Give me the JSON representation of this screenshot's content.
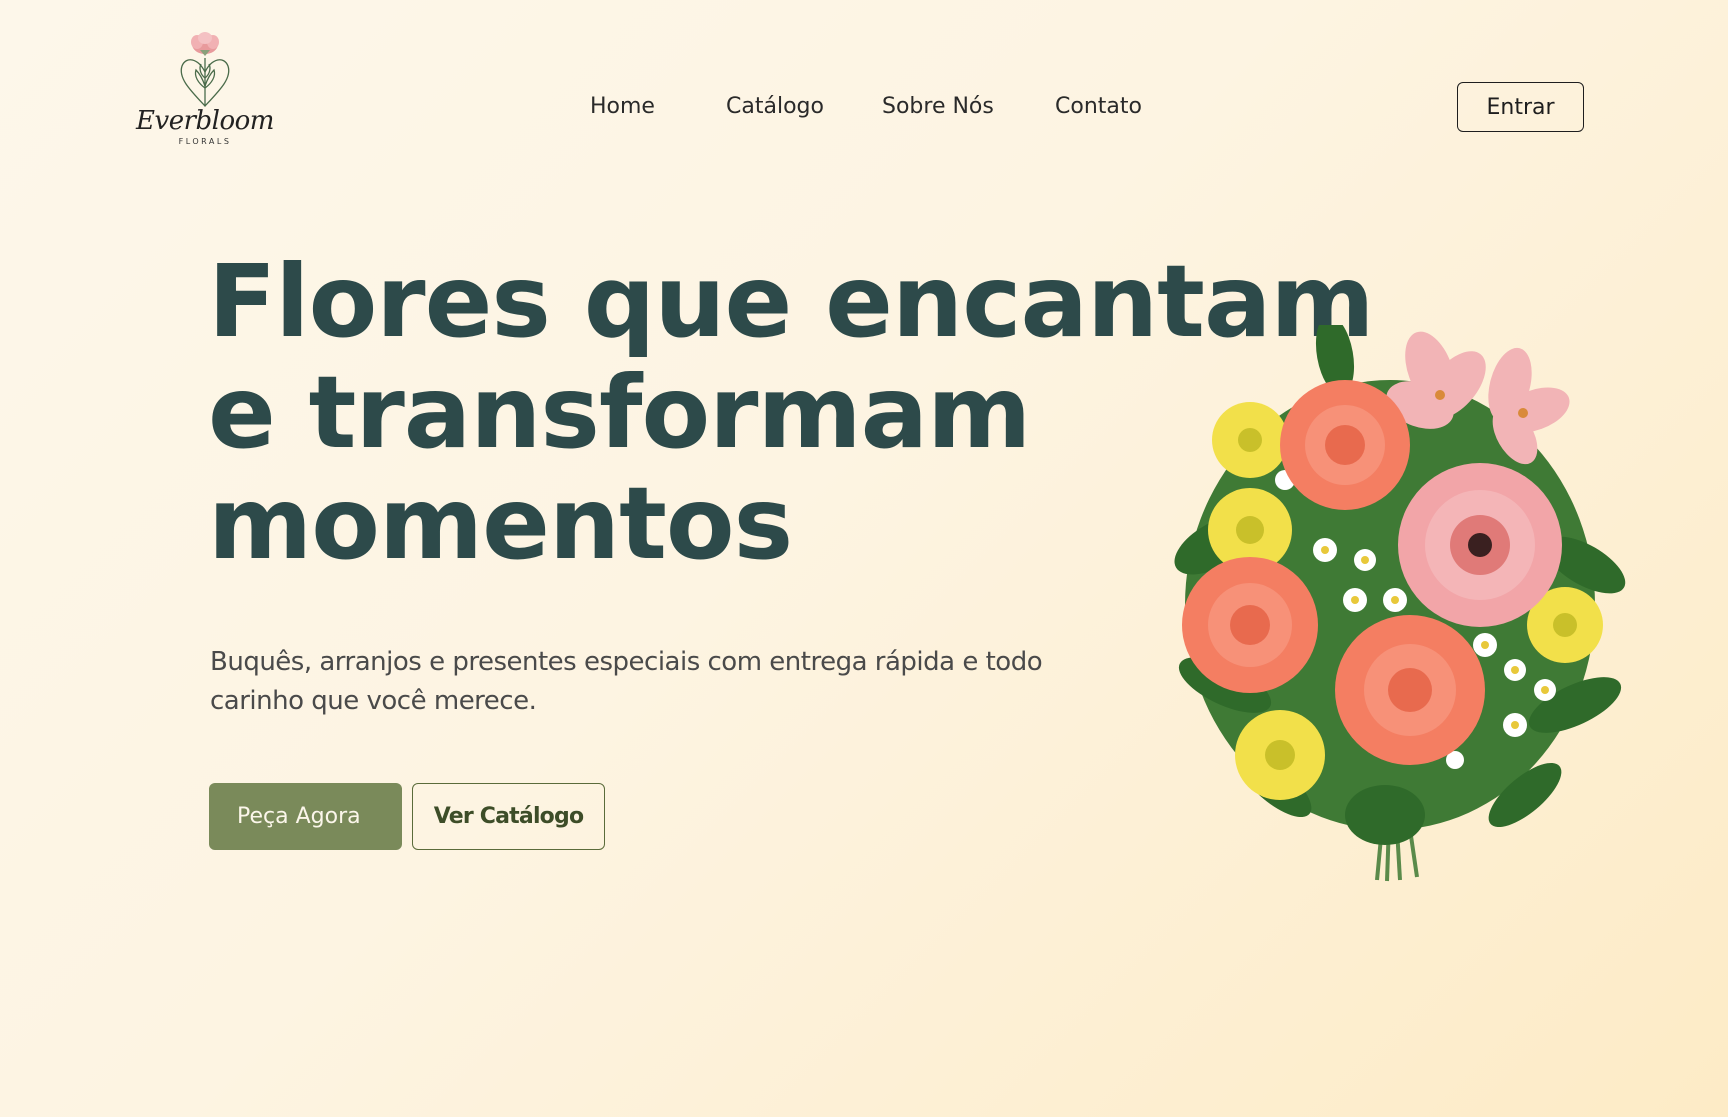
{
  "brand": {
    "name": "Everbloom",
    "subtitle": "FLORALS"
  },
  "nav": {
    "items": [
      {
        "label": "Home"
      },
      {
        "label": "Catálogo"
      },
      {
        "label": "Sobre Nós"
      },
      {
        "label": "Contato"
      }
    ],
    "login_label": "Entrar"
  },
  "hero": {
    "title_lines": [
      "Flores que encantam",
      "e transformam",
      "momentos"
    ],
    "subtitle": "Buquês, arranjos e presentes especiais com entrega rápida e todo carinho que você merece.",
    "primary_cta": "Peça Agora",
    "secondary_cta": "Ver Catálogo",
    "image_icon": "flower-bouquet-illustration"
  },
  "colors": {
    "background": "#fdf4e2",
    "title": "#2d4a4a",
    "primary_button": "#7a8a5a",
    "secondary_button_border": "#5a6b3a",
    "rose": "#f47e62",
    "pink": "#f2a5a8",
    "yellow": "#f2e04a",
    "leaf": "#3f7a35"
  }
}
